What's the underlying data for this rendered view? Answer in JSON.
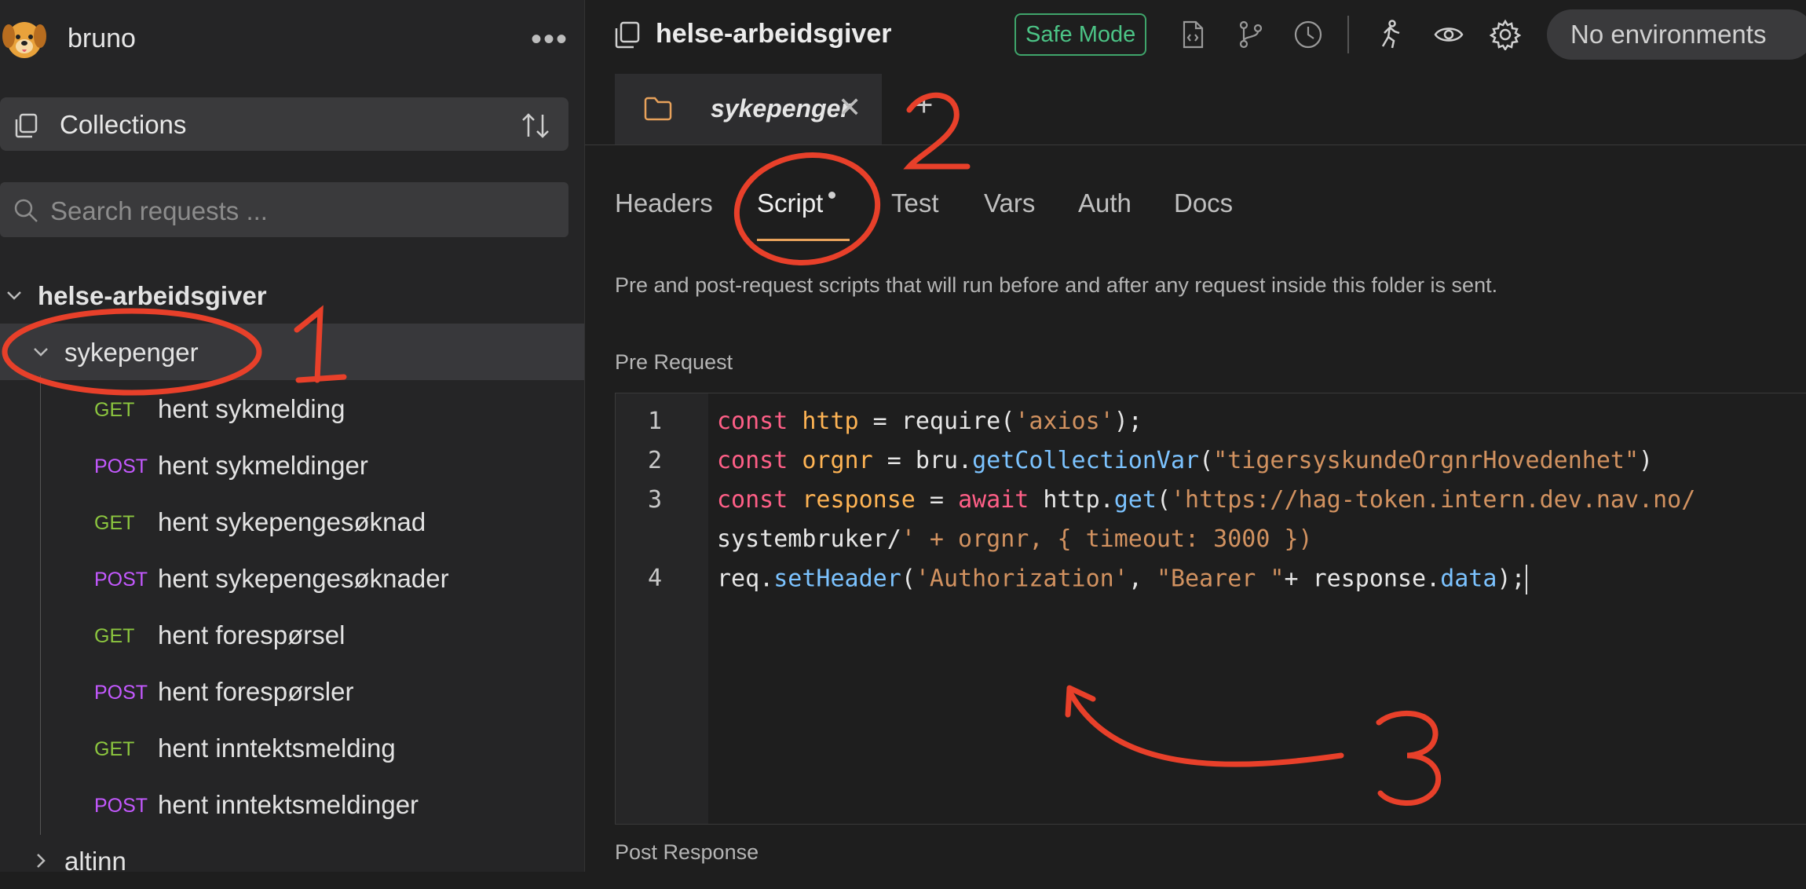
{
  "app": {
    "name": "bruno"
  },
  "sidebar": {
    "collections_label": "Collections",
    "search_placeholder": "Search requests ...",
    "tree": {
      "root": "helse-arbeidsgiver",
      "folder": "sykepenger",
      "requests": [
        {
          "method": "GET",
          "name": "hent sykmelding"
        },
        {
          "method": "POST",
          "name": "hent sykmeldinger"
        },
        {
          "method": "GET",
          "name": "hent sykepengesøknad"
        },
        {
          "method": "POST",
          "name": "hent sykepengesøknader"
        },
        {
          "method": "GET",
          "name": "hent forespørsel"
        },
        {
          "method": "POST",
          "name": "hent forespørsler"
        },
        {
          "method": "GET",
          "name": "hent inntektsmelding"
        },
        {
          "method": "POST",
          "name": "hent inntektsmeldinger"
        }
      ],
      "next_folder": "altinn"
    }
  },
  "header": {
    "title": "helse-arbeidsgiver",
    "safe_mode": "Safe Mode",
    "environment": "No environments"
  },
  "tabs": [
    {
      "label": "sykepenger"
    }
  ],
  "subtabs": [
    "Headers",
    "Script",
    "Test",
    "Vars",
    "Auth",
    "Docs"
  ],
  "colors": {
    "accent": "#e8a25b",
    "get": "#8cc63f",
    "post": "#c459ff",
    "safe": "#4cc486",
    "annotation": "#e8402a"
  },
  "script": {
    "description": "Pre and post-request scripts that will run before and after any request inside this folder is sent.",
    "pre_request_label": "Pre Request",
    "post_response_label": "Post Response",
    "line_numbers": [
      "1",
      "2",
      "3",
      "4"
    ],
    "lines": [
      "const http = require('axios');",
      "const orgnr = bru.getCollectionVar(\"tigersyskundeOrgnrHovedenhet\")",
      "const response = await http.get('https://hag-token.intern.dev.nav.no/",
      "systembruker/' + orgnr, { timeout: 3000 })",
      "req.setHeader('Authorization', \"Bearer \"+ response.data);"
    ]
  },
  "annotations": [
    "1",
    "2",
    "3"
  ]
}
